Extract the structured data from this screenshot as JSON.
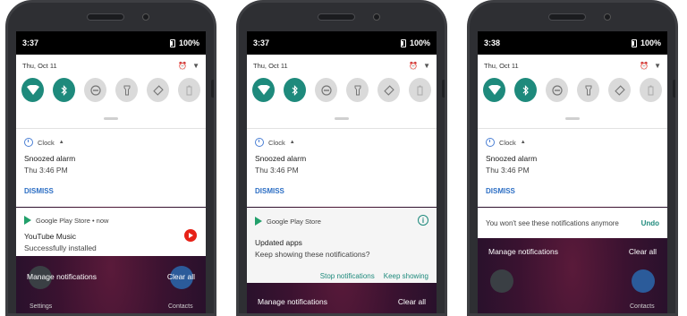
{
  "phones": [
    {
      "status": {
        "time": "3:37",
        "battery": "100%"
      },
      "qs": {
        "date": "Thu, Oct 11"
      },
      "clock_notif": {
        "app": "Clock",
        "title": "Snoozed alarm",
        "text": "Thu 3:46 PM",
        "action": "DISMISS"
      },
      "play_notif": {
        "app": "Google Play Store • now",
        "title": "YouTube Music",
        "text": "Successfully installed"
      },
      "footer": {
        "manage": "Manage notifications",
        "clear": "Clear all"
      },
      "home": {
        "left": "Settings",
        "right": "Contacts"
      }
    },
    {
      "status": {
        "time": "3:37",
        "battery": "100%"
      },
      "qs": {
        "date": "Thu, Oct 11"
      },
      "clock_notif": {
        "app": "Clock",
        "title": "Snoozed alarm",
        "text": "Thu 3:46 PM",
        "action": "DISMISS"
      },
      "play_notif": {
        "app": "Google Play Store",
        "title": "Updated apps",
        "text": "Keep showing these notifications?",
        "stop": "Stop notifications",
        "keep": "Keep showing"
      },
      "footer": {
        "manage": "Manage notifications",
        "clear": "Clear all"
      }
    },
    {
      "status": {
        "time": "3:38",
        "battery": "100%"
      },
      "qs": {
        "date": "Thu, Oct 11"
      },
      "clock_notif": {
        "app": "Clock",
        "title": "Snoozed alarm",
        "text": "Thu 3:46 PM",
        "action": "DISMISS"
      },
      "snoozed": {
        "text": "You won't see these notifications anymore",
        "undo": "Undo"
      },
      "footer": {
        "manage": "Manage notifications",
        "clear": "Clear all"
      },
      "home": {
        "right": "Contacts"
      }
    }
  ],
  "icons": {
    "wifi": "wifi-icon",
    "bluetooth": "bluetooth-icon",
    "dnd": "do-not-disturb-icon",
    "flashlight": "flashlight-icon",
    "rotate": "auto-rotate-icon",
    "battery_saver": "battery-saver-icon"
  },
  "colors": {
    "accent": "#1e8a7c",
    "link": "#2d6fc4",
    "youtube": "#e62117"
  }
}
